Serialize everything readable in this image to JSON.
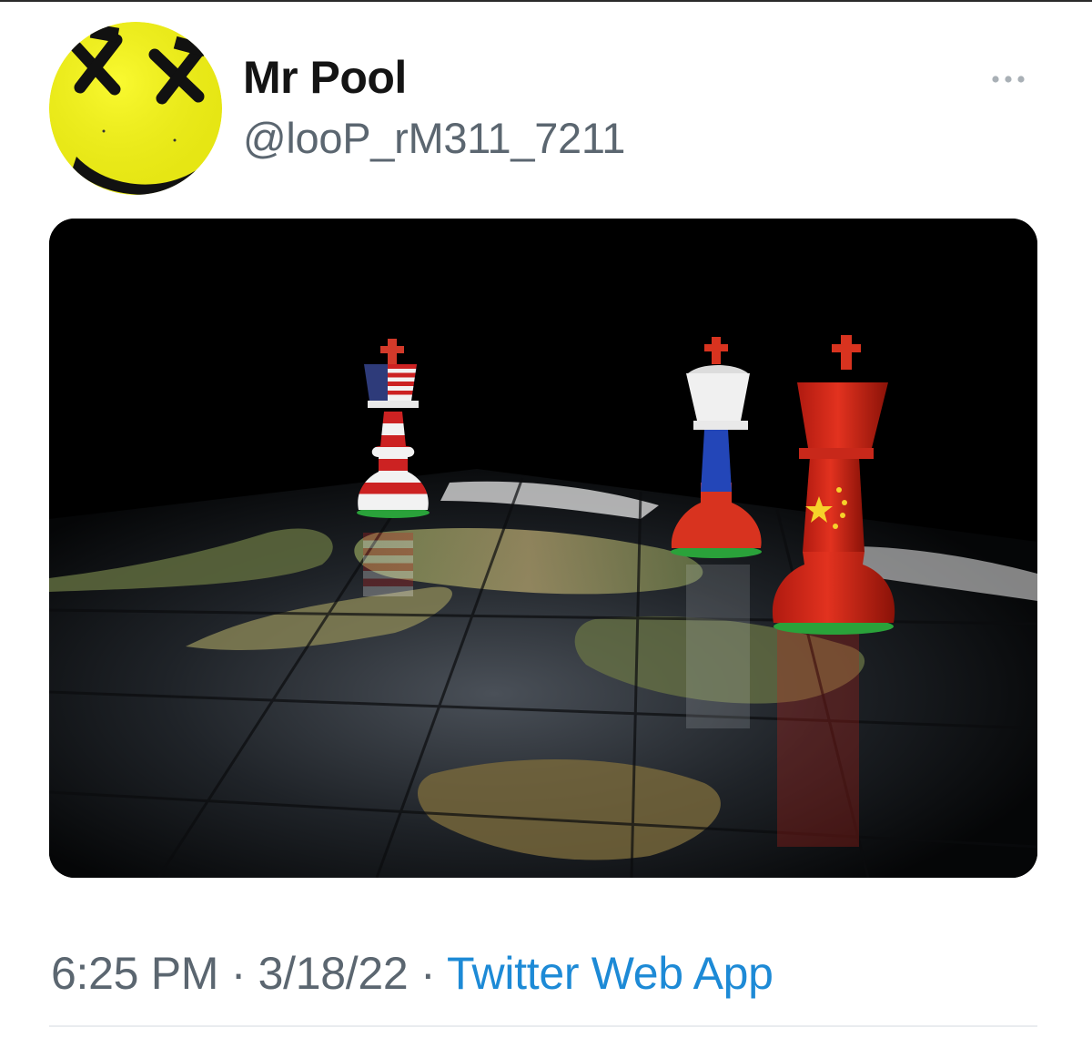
{
  "tweet": {
    "display_name": "Mr Pool",
    "handle": "@looP_rM311_7211",
    "avatar_icon": "yellow-smiley-avatar",
    "more_icon": "more-horizontal-icon",
    "image_description_icon": "chess-kings-on-world-map-image",
    "time": "6:25 PM",
    "separator": "·",
    "date": "3/18/22",
    "source": "Twitter Web App"
  },
  "colors": {
    "name": "#141414",
    "secondary": "#5b6670",
    "link": "#1d8ad6",
    "avatar_yellow": "#f2f21a"
  }
}
